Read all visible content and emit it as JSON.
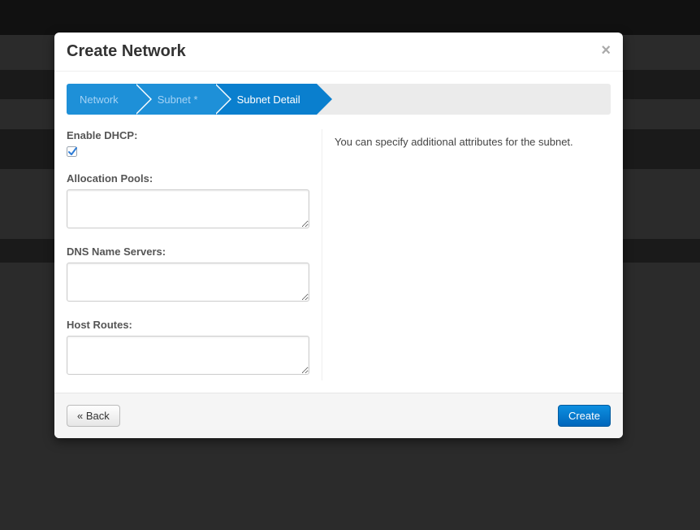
{
  "modal": {
    "title": "Create Network",
    "close_glyph": "×"
  },
  "wizard": {
    "steps": [
      {
        "label": "Network"
      },
      {
        "label": "Subnet *"
      },
      {
        "label": "Subnet Detail"
      }
    ]
  },
  "form": {
    "enable_dhcp_label": "Enable DHCP:",
    "enable_dhcp_checked": true,
    "allocation_pools_label": "Allocation Pools:",
    "allocation_pools_value": "",
    "dns_name_servers_label": "DNS Name Servers:",
    "dns_name_servers_value": "",
    "host_routes_label": "Host Routes:",
    "host_routes_value": ""
  },
  "help_text": "You can specify additional attributes for the subnet.",
  "footer": {
    "back_label": "« Back",
    "create_label": "Create"
  }
}
